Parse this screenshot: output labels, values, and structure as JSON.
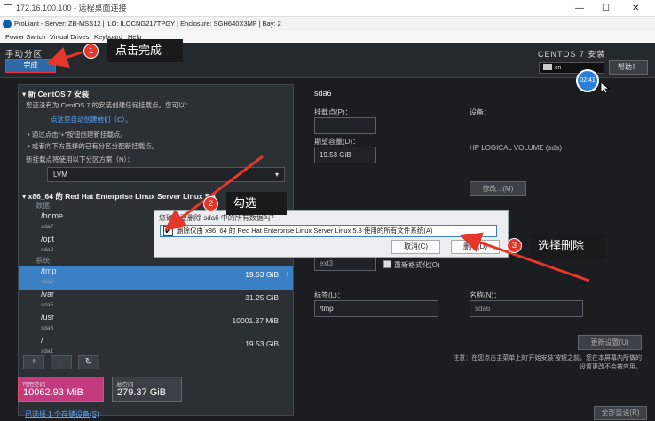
{
  "rd_window": {
    "title": "172.16.100.100 - 远程桌面连接",
    "controls": [
      "—",
      "☐",
      "✕"
    ]
  },
  "ilo": {
    "info": "ProLiant - Server: ZB-MSS12 | iLO: ILOCNG217TPGY | Enclosure: SGH640X3MF | Bay: 2"
  },
  "menu": [
    "Power Switch",
    "Virtual Drives",
    "Keyboard",
    "Help"
  ],
  "header": {
    "page_title": "手动分区",
    "done_label": "完成",
    "product": "CENTOS 7 安装",
    "keyboard": "cn",
    "help_label": "帮助！",
    "timer": "02:41"
  },
  "left": {
    "new_install_title": "▾ 新 CentOS 7 安装",
    "intro": "您还没有为 CentOS 7 的安装创建任何挂载点。您可以：",
    "auto_link": "点这里自动创建他们（C）。",
    "bullet1": "• 通过点击\"+\"按钮创建新挂载点。",
    "bullet2": "• 或者向下方选择的已有分区分配新挂载点。",
    "scheme_label": "新挂载点将使用以下分区方案（N）：",
    "scheme_value": "LVM",
    "rhel_title": "▾ x86_64 的 Red Hat Enterprise Linux Server Linux 5.8",
    "group_data": "数据",
    "group_system": "系统",
    "mounts": [
      {
        "name": "/home",
        "dev": "sda7",
        "size": ""
      },
      {
        "name": "/opt",
        "dev": "sda2",
        "size": ""
      },
      {
        "name": "/tmp",
        "dev": "sda6",
        "size": "19.53 GiB"
      },
      {
        "name": "/var",
        "dev": "sda5",
        "size": "31.25 GiB"
      },
      {
        "name": "/usr",
        "dev": "sda8",
        "size": "10001.37 MiB"
      },
      {
        "name": "/",
        "dev": "sda1",
        "size": "19.53 GiB"
      }
    ],
    "btn_add": "+",
    "btn_remove": "−",
    "btn_refresh": "↻",
    "avail_label": "可用空间",
    "avail_value": "10062.93 MiB",
    "total_label": "总空间",
    "total_value": "279.37 GiB",
    "devices_link": "已选择 1 个存储设备(S)"
  },
  "right": {
    "part_name": "sda6",
    "mount_label": "挂载点(P)：",
    "mount_value": "",
    "device_label": "设备：",
    "capacity_label": "期望容量(D)：",
    "capacity_value": "19.53 GiB",
    "device_value": "HP LOGICAL VOLUME (sda)",
    "modify_label": "修改...(M)",
    "fs_value": "ext3",
    "reformat_label": "重新格式化(O)",
    "tag_label": "标签(L)：",
    "tag_value": "/tmp",
    "name_label": "名称(N)：",
    "name_value": "sda6",
    "update_label": "更新设置(U)",
    "note": "注意：在您点击主菜单上的'开始安装'按钮之前，您在本屏幕内所做的设置更改不会被应用。",
    "reset_label": "全部重设(R)"
  },
  "dialog": {
    "question": "您确定要删除 sda6 中的所有数据吗？",
    "checkbox": "删除仅由 x86_64 的 Red Hat Enterprise Linux Server Linux 5.8 使用的所有文件系统(A)",
    "check_mark": "✔",
    "cancel_label": "取消(C)",
    "delete_label": "删除(D)"
  },
  "annotations": [
    {
      "num": "1",
      "text": "点击完成"
    },
    {
      "num": "2",
      "text": "勾选"
    },
    {
      "num": "3",
      "text": "选择删除"
    }
  ],
  "colors": {
    "arrow": "#e3372b",
    "selected_row": "#3b7fc4",
    "available": "#c33a7f"
  }
}
